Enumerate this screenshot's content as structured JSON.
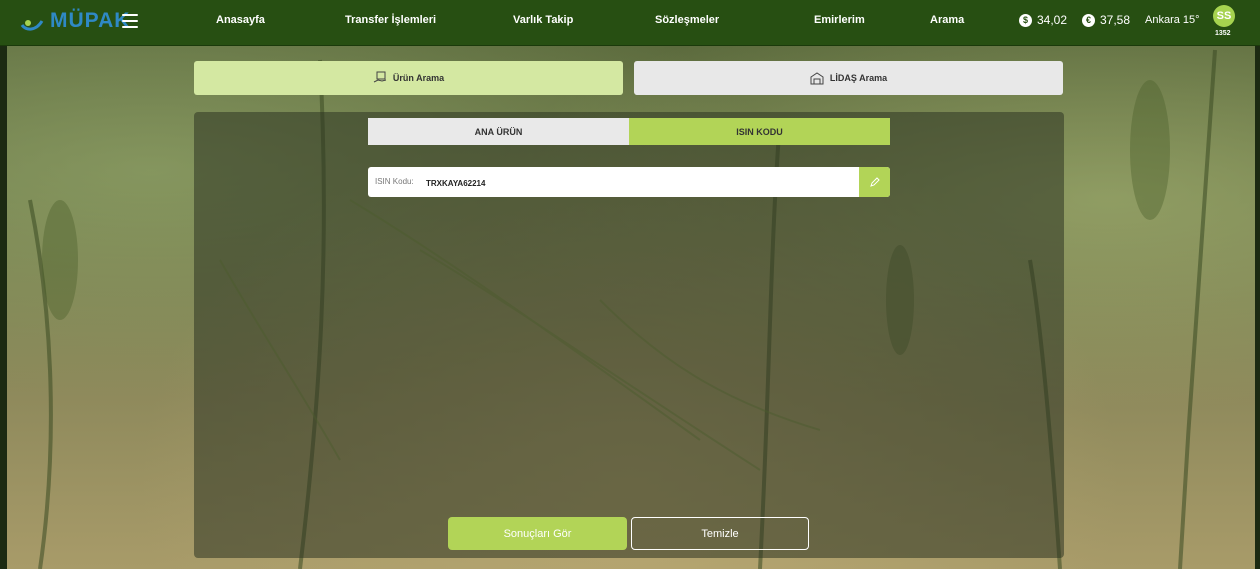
{
  "brand": {
    "name": "MÜPAK",
    "logo_icon": "mupak-logo"
  },
  "nav": {
    "menu_icon": "hamburger-icon",
    "items": [
      {
        "label": "Anasayfa"
      },
      {
        "label": "Transfer İşlemleri"
      },
      {
        "label": "Varlık Takip"
      },
      {
        "label": "Sözleşmeler"
      },
      {
        "label": "Emirlerim"
      },
      {
        "label": "Arama"
      }
    ]
  },
  "rates": [
    {
      "symbol": "$",
      "value": "34,02",
      "icon": "dollar-icon"
    },
    {
      "symbol": "€",
      "value": "37,58",
      "icon": "euro-icon"
    }
  ],
  "weather": {
    "text": "Ankara 15°"
  },
  "user": {
    "initials": "SS",
    "number": "1352"
  },
  "search_types": {
    "product": {
      "label": "Ürün Arama",
      "icon": "box-hand-icon"
    },
    "lidas": {
      "label": "LİDAŞ Arama",
      "icon": "warehouse-icon"
    }
  },
  "tabs": {
    "main_product": {
      "label": "ANA ÜRÜN"
    },
    "isin": {
      "label": "ISIN KODU"
    }
  },
  "isin_field": {
    "label": "ISIN Kodu:",
    "value": "TRXKAYA62214",
    "edit_icon": "pencil-icon"
  },
  "actions": {
    "results": "Sonuçları Gör",
    "clear": "Temizle"
  },
  "colors": {
    "header": "#274f12",
    "accent": "#b2d457",
    "active_type": "#d4e8a2",
    "avatar": "#a6d34f"
  }
}
